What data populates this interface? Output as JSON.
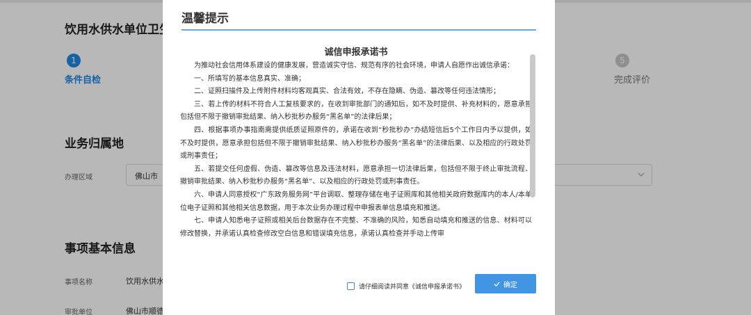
{
  "background": {
    "page_title": "饮用水供水单位卫生",
    "steps": [
      {
        "number": "1",
        "label": "条件自检"
      },
      {
        "number": "5",
        "label": "完成评价"
      }
    ],
    "section_region": {
      "heading": "业务归属地",
      "field_label": "办理区域",
      "select_value": "佛山市"
    },
    "section_item": {
      "heading": "事项基本信息",
      "fields": [
        {
          "label": "事项名称",
          "value": "饮用水供水单"
        },
        {
          "label": "审批单位",
          "value": "佛山市顺德"
        }
      ]
    }
  },
  "modal": {
    "title": "温馨提示",
    "doc_title": "诚信申报承诺书",
    "paragraphs": [
      "为推动社会信用体系建设的健康发展，营造诚实守信、规范有序的社会环境，申请人自愿作出诚信承诺：",
      "一、所填写的基本信息真实、准确；",
      "二、证照扫描件及上传附件材料均客观真实、合法有效，不存在隐瞒、伪造、篡改等任何违法情形；",
      "三、若上传的材料不符合人工复核要求的，在收到审批部门的通知后，如不及时提供、补充材料的，愿意承担包括但不限于撤销审批结果、纳入秒批秒办服务“黑名单”的法律后果；",
      "四、根据事项办事指南需提供纸质证照原件的，承诺在收到“秒批秒办”办结短信后5个工作日内予以提供，如不及时提供，愿意承担包括但不限于撤销审批结果、纳入秒批秒办服务“黑名单”的法律后果、以及相应的行政处罚或刑事责任；",
      "五、若提交任何虚假、伪造、篡改等信息及违法材料，愿意承担一切法律后果，包括但不限于终止审批流程、撤销审批结果、纳入秒批秒办服务“黑名单”、以及相应的行政处罚或刑事责任。",
      "六、申请人同意授权“广东政务服务网”平台调取、整理存储在电子证照库和其他相关政府数据库内的本人/本单位电子证照和其他相关信息数据，用于本次业务办理过程中申报表单信息填充和推送。",
      "七、申请人知悉电子证照或相关后台数据存在不完整、不准确的风险，知悉自动填充和推送的信息、材料可以修改替换，并承诺认真检查修改空白信息和错误填充信息，承诺认真检查并手动上传审"
    ],
    "agree_text": "请仔细阅读并同意《诚信申报承诺书》",
    "agree_checked": false,
    "confirm_label": "确定",
    "icons": {
      "confirm": "check-icon",
      "select": "chevron-down-icon"
    },
    "colors": {
      "accent": "#4195e3",
      "title_rule": "#6aa5de",
      "step_active": "#1e88e5",
      "step_inactive": "#c6c6c6"
    }
  }
}
